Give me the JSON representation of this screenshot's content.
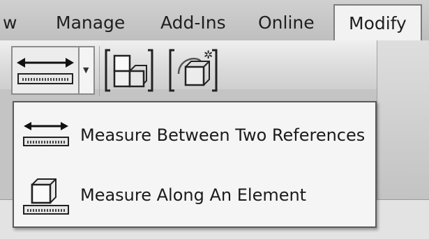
{
  "ribbon": {
    "tabs": [
      {
        "label": "w"
      },
      {
        "label": "Manage"
      },
      {
        "label": "Add-Ins"
      },
      {
        "label": "Online"
      },
      {
        "label": "Modify"
      }
    ],
    "active_tab": "Modify",
    "measure_button_icon": "measure-between-icon",
    "tool_icons": [
      "copy-elements-icon",
      "create-similar-icon"
    ]
  },
  "menu": {
    "items": [
      {
        "label": "Measure Between Two References",
        "icon": "measure-between-icon"
      },
      {
        "label": "Measure Along An Element",
        "icon": "measure-along-icon"
      }
    ]
  },
  "colors": {
    "tab_bar": "#c8c8c8",
    "active_tab": "#f2f2f2",
    "menu_background": "#f5f5f5",
    "menu_border": "#5a5a5a"
  }
}
